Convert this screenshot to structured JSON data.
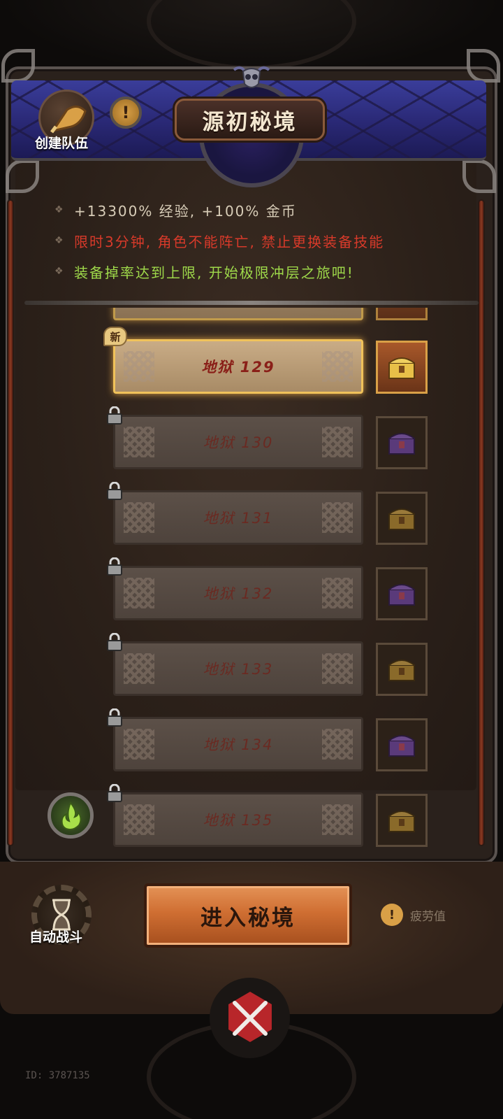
{
  "header": {
    "title": "源初秘境",
    "team_label": "创建队伍",
    "info_symbol": "!"
  },
  "rules": [
    {
      "text": "+13300% 经验, +100% 金币",
      "color": "#d8cdb8"
    },
    {
      "text": "限时3分钟, 角色不能阵亡, 禁止更换装备技能",
      "color": "#d83a2a"
    },
    {
      "text": "装备掉率达到上限, 开始极限冲层之旅吧!",
      "color": "#9ed84a"
    }
  ],
  "levels": [
    {
      "label": "地狱 129",
      "new_badge": "新",
      "locked": false,
      "active": true,
      "chest": "gold"
    },
    {
      "label": "地狱 130",
      "locked": true,
      "active": false,
      "chest": "purple"
    },
    {
      "label": "地狱 131",
      "locked": true,
      "active": false,
      "chest": "gold"
    },
    {
      "label": "地狱 132",
      "locked": true,
      "active": false,
      "chest": "purple"
    },
    {
      "label": "地狱 133",
      "locked": true,
      "active": false,
      "chest": "gold"
    },
    {
      "label": "地狱 134",
      "locked": true,
      "active": false,
      "chest": "purple"
    },
    {
      "label": "地狱 135",
      "locked": true,
      "active": false,
      "chest": "gold"
    }
  ],
  "bottom": {
    "auto_battle_label": "自动战斗",
    "enter_button_label": "进入秘境",
    "fatigue_label": "疲劳值",
    "fatigue_symbol": "!"
  },
  "footer": {
    "id_text": "ID: 3787135"
  },
  "colors": {
    "accent_gold": "#d9a047",
    "enter_button": "#cf6e32",
    "banner_blue": "#2b2a78"
  }
}
